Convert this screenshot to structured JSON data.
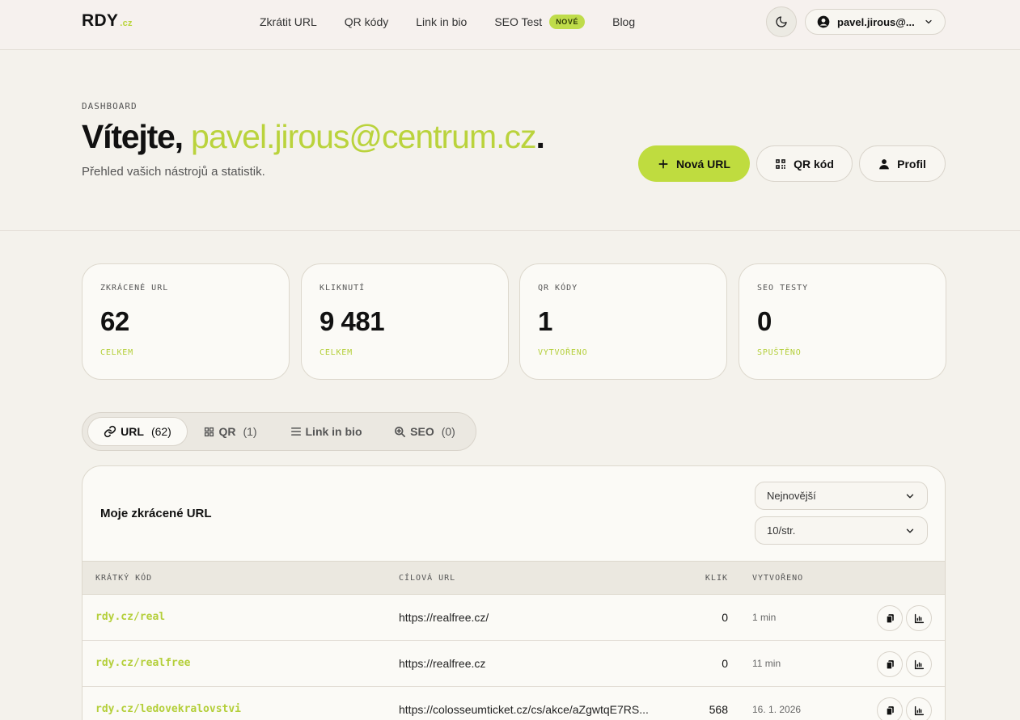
{
  "header": {
    "logo": "RDY",
    "logo_tld": ".cz",
    "nav": [
      "Zkrátit URL",
      "QR kódy",
      "Link in bio",
      "SEO Test",
      "Blog"
    ],
    "new_badge": "NOVÉ",
    "user_label": "pavel.jirous@..."
  },
  "hero": {
    "eyebrow": "DASHBOARD",
    "greeting": "Vítejte, ",
    "email": "pavel.jirous@centrum.cz",
    "period": ".",
    "subtitle": "Přehled vašich nástrojů a statistik.",
    "btn_new": "Nová URL",
    "btn_qr": "QR kód",
    "btn_profile": "Profil"
  },
  "stats": [
    {
      "label": "ZKRÁCENÉ URL",
      "value": "62",
      "sub": "CELKEM"
    },
    {
      "label": "KLIKNUTÍ",
      "value": "9 481",
      "sub": "CELKEM"
    },
    {
      "label": "QR KÓDY",
      "value": "1",
      "sub": "VYTVOŘENO"
    },
    {
      "label": "SEO TESTY",
      "value": "0",
      "sub": "SPUŠTĚNO"
    }
  ],
  "tabs": [
    {
      "label": "URL",
      "count": "(62)"
    },
    {
      "label": "QR",
      "count": "(1)"
    },
    {
      "label": "Link in bio",
      "count": ""
    },
    {
      "label": "SEO",
      "count": "(0)"
    }
  ],
  "panel": {
    "title": "Moje zkrácené URL",
    "sort_value": "Nejnovější",
    "page_size_value": "10/str.",
    "columns": [
      "KRÁTKÝ KÓD",
      "CÍLOVÁ URL",
      "KLIK",
      "VYTVOŘENO"
    ],
    "rows": [
      {
        "code": "rdy.cz/real",
        "url": "https://realfree.cz/",
        "clicks": "0",
        "created": "1 min"
      },
      {
        "code": "rdy.cz/realfree",
        "url": "https://realfree.cz",
        "clicks": "0",
        "created": "11 min"
      },
      {
        "code": "rdy.cz/ledovekralovstvi",
        "url": "https://colosseumticket.cz/cs/akce/aZgwtqE7RS...",
        "clicks": "568",
        "created": "16. 1. 2026"
      }
    ]
  },
  "colors": {
    "accent": "#bfdc3f",
    "accent_text": "#bad33c",
    "background": "#f4f2ec"
  }
}
